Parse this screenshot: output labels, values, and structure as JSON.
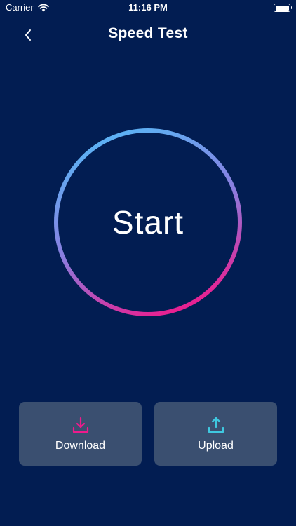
{
  "status_bar": {
    "carrier": "Carrier",
    "time": "11:16 PM"
  },
  "nav": {
    "title": "Speed Test"
  },
  "start": {
    "label": "Start"
  },
  "buttons": {
    "download_label": "Download",
    "upload_label": "Upload"
  },
  "colors": {
    "background": "#021d52",
    "ring_start": "#5ab4f5",
    "ring_end": "#ee1a8c",
    "button_bg": "#3a4f70",
    "download_icon": "#ee1a8c",
    "upload_icon": "#3fc8e0"
  },
  "icons": {
    "wifi": "wifi-icon",
    "battery": "battery-icon",
    "back": "chevron-left-icon",
    "download": "download-icon",
    "upload": "upload-icon"
  }
}
